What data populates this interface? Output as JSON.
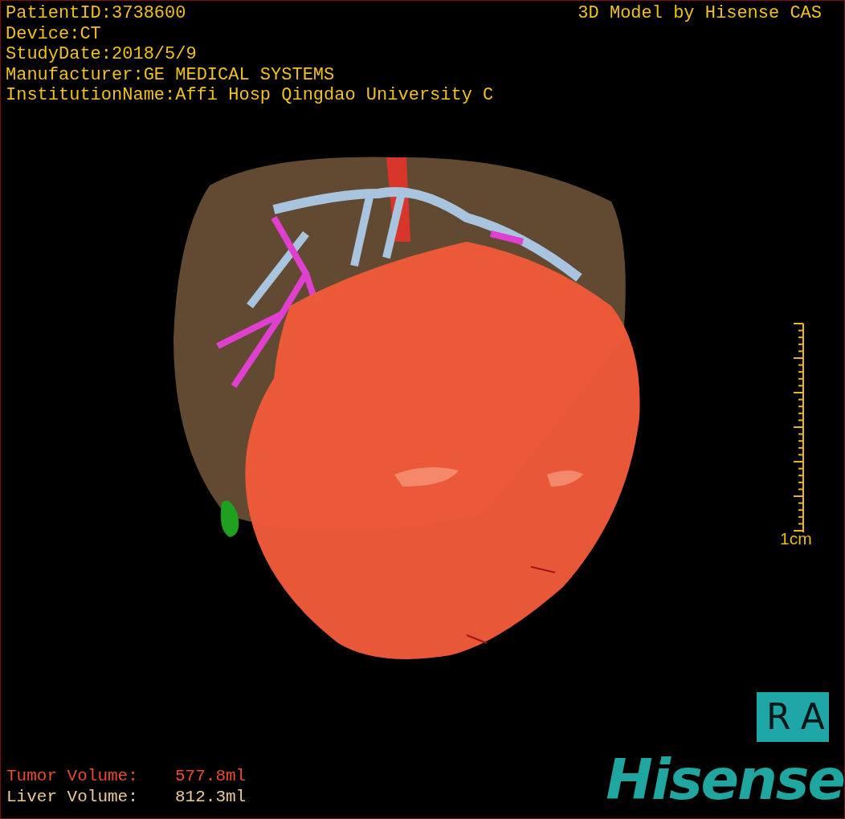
{
  "patient_info": [
    "PatientID:3738600",
    "Device:CT",
    "StudyDate:2018/5/9",
    "Manufacturer:GE MEDICAL SYSTEMS",
    "InstitutionName:Affi Hosp Qingdao University C"
  ],
  "model_credit": "3D Model by Hisense CAS",
  "scale": {
    "label": "1cm"
  },
  "orientation": "RA",
  "volumes": [
    {
      "kind": "tumor",
      "label": "Tumor Volume:",
      "value": "577.8ml"
    },
    {
      "kind": "liver",
      "label": "Liver Volume:",
      "value": "812.3ml"
    }
  ],
  "logo": "Hisense"
}
